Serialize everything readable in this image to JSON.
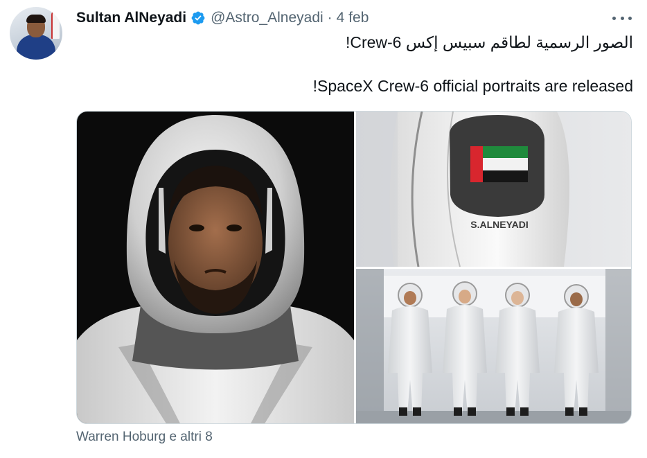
{
  "tweet": {
    "author_name": "Sultan AlNeyadi",
    "handle": "@Astro_Alneyadi",
    "separator": "·",
    "date": "4 feb",
    "text_arabic": "الصور الرسمية لطاقم سبيس إكس Crew-6!",
    "text_english": "SpaceX Crew-6 official portraits are released!",
    "verified": true
  },
  "media": {
    "patch_name_text": "S.ALNEYADI"
  },
  "footer": {
    "tagged_users": "Warren Hoburg e altri 8"
  },
  "icons": {
    "verified": "verified-badge-icon",
    "more": "more-options-icon"
  },
  "colors": {
    "verified_blue": "#1d9bf0",
    "secondary_text": "#536471",
    "primary_text": "#0f1419"
  }
}
